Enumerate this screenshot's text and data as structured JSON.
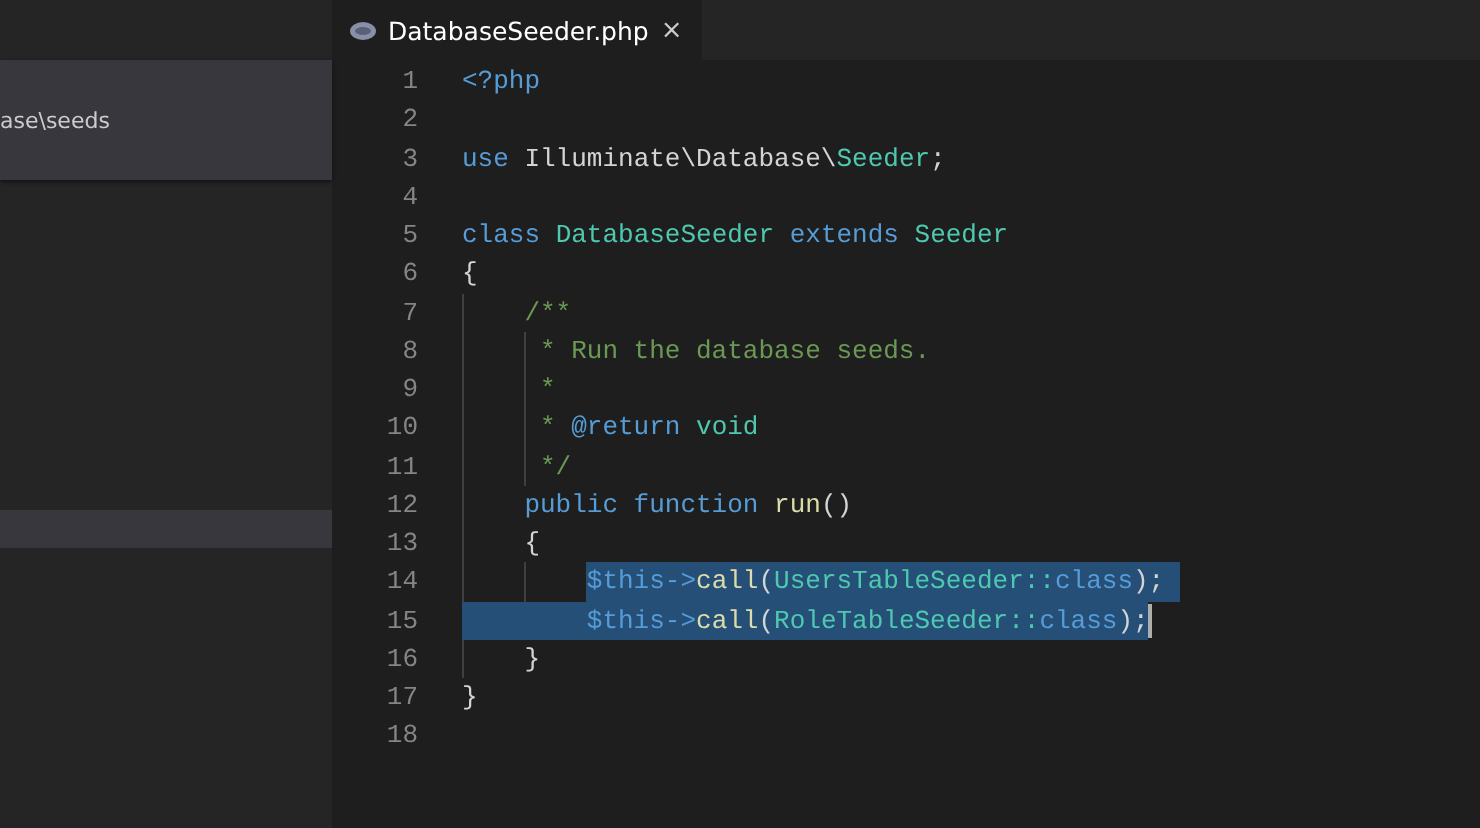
{
  "sidebar": {
    "path": "ase\\seeds",
    "selected_row": true
  },
  "tabs": [
    {
      "label": "DatabaseSeeder.php",
      "selected": true,
      "close": "×"
    }
  ],
  "lines": [
    {
      "number": "1",
      "tokens": [
        {
          "kind": "keyword",
          "text": "<?php"
        }
      ]
    },
    {
      "number": "2"
    },
    {
      "number": "3",
      "tokens": [
        {
          "kind": "keyword",
          "text": "use"
        },
        {
          "kind": "plain",
          "text": " Illuminate\\Database\\"
        },
        {
          "kind": "type",
          "text": "Seeder"
        },
        {
          "kind": "plain",
          "text": ";"
        }
      ]
    },
    {
      "number": "4"
    },
    {
      "number": "5",
      "tokens": [
        {
          "kind": "keyword",
          "text": "class"
        },
        {
          "kind": "type",
          "text": " DatabaseSeeder"
        },
        {
          "kind": "keyword",
          "text": " extends"
        },
        {
          "kind": "type",
          "text": " Seeder"
        }
      ]
    },
    {
      "number": "6",
      "tokens": [
        {
          "kind": "plain",
          "text": "{"
        }
      ],
      "children": [
        {
          "number": "7",
          "tokens": [
            {
              "kind": "comment",
              "text": "/**"
            }
          ]
        },
        {
          "number": "8",
          "tokens": [
            {
              "kind": "comment",
              "text": " * Run the database seeds."
            }
          ]
        },
        {
          "number": "9",
          "tokens": [
            {
              "kind": "comment",
              "text": " *"
            }
          ]
        },
        {
          "number": "10",
          "tokens": [
            {
              "kind": "comment",
              "text": " *"
            },
            {
              "kind": "doc_tag",
              "text": " @return"
            },
            {
              "kind": "doc_type",
              "text": " void"
            }
          ]
        },
        {
          "number": "11",
          "tokens": [
            {
              "kind": "comment",
              "text": " */"
            }
          ]
        },
        {
          "number": "12",
          "tokens": [
            {
              "kind": "keyword",
              "text": "public"
            },
            {
              "kind": "keyword",
              "text": " function"
            },
            {
              "kind": "function",
              "text": " run"
            },
            {
              "kind": "plain",
              "text": "()"
            }
          ]
        },
        {
          "number": "13",
          "tokens": [
            {
              "kind": "plain",
              "text": "{"
            }
          ],
          "children": [
            {
              "number": "14",
              "selected": true,
              "tokens": [
                {
                  "kind": "variable",
                  "text": "$this"
                },
                {
                  "kind": "keyword",
                  "text": "->"
                },
                {
                  "kind": "function",
                  "text": "call"
                },
                {
                  "kind": "plain",
                  "text": "("
                },
                {
                  "kind": "type",
                  "text": "UsersTableSeeder"
                },
                {
                  "kind": "type",
                  "text": "::"
                },
                {
                  "kind": "keyword",
                  "text": "class"
                },
                {
                  "kind": "plain",
                  "text": ");"
                }
              ]
            },
            {
              "number": "15",
              "selected": true,
              "cursor": true,
              "tokens": [
                {
                  "kind": "variable",
                  "text": "$this"
                },
                {
                  "kind": "keyword",
                  "text": "->"
                },
                {
                  "kind": "function",
                  "text": "call"
                },
                {
                  "kind": "plain",
                  "text": "("
                },
                {
                  "kind": "type",
                  "text": "RoleTableSeeder"
                },
                {
                  "kind": "type",
                  "text": "::"
                },
                {
                  "kind": "keyword",
                  "text": "class"
                },
                {
                  "kind": "plain",
                  "text": ");"
                }
              ]
            }
          ]
        },
        {
          "number": "16",
          "tokens": [
            {
              "kind": "plain",
              "text": "}"
            }
          ]
        }
      ]
    },
    {
      "number": "17",
      "tokens": [
        {
          "kind": "plain",
          "text": "}"
        }
      ]
    },
    {
      "number": "18"
    }
  ]
}
